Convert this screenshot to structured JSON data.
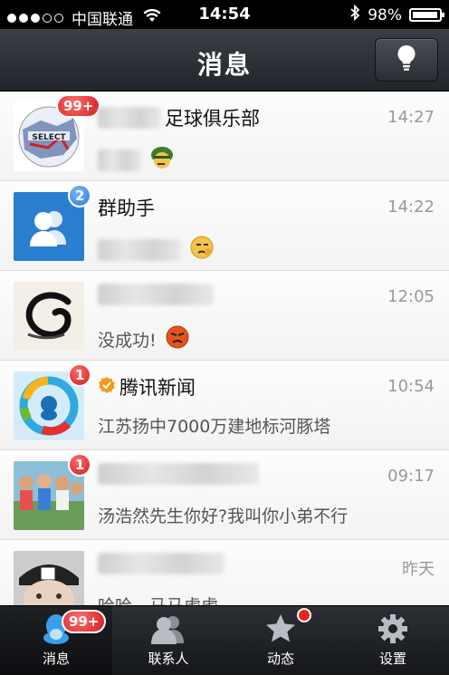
{
  "status_bar": {
    "carrier": "中国联通",
    "time": "14:54",
    "battery": "98%"
  },
  "navbar": {
    "title": "消息"
  },
  "conversations": [
    {
      "name": "足球俱乐部",
      "time": "14:27",
      "badge": "99+",
      "preview": ""
    },
    {
      "name": "群助手",
      "time": "14:22",
      "badge": "2",
      "preview": ""
    },
    {
      "name": "",
      "time": "12:05",
      "badge": "",
      "preview": "没成功!"
    },
    {
      "name": "腾讯新闻",
      "time": "10:54",
      "badge": "1",
      "preview": "江苏扬中7000万建地标河豚塔"
    },
    {
      "name": "",
      "time": "09:17",
      "badge": "1",
      "preview": "汤浩然先生你好?我叫你小弟不行"
    },
    {
      "name": "",
      "time": "昨天",
      "badge": "",
      "preview": "哈哈，马马虎虎"
    }
  ],
  "tabbar": {
    "tabs": [
      {
        "label": "消息",
        "badge": "99+"
      },
      {
        "label": "联系人"
      },
      {
        "label": "动态"
      },
      {
        "label": "设置"
      }
    ]
  },
  "colors": {
    "badge_red": "#d21f1f",
    "badge_blue": "#2e7ad8",
    "group_helper_bg": "#2a7ed0"
  }
}
